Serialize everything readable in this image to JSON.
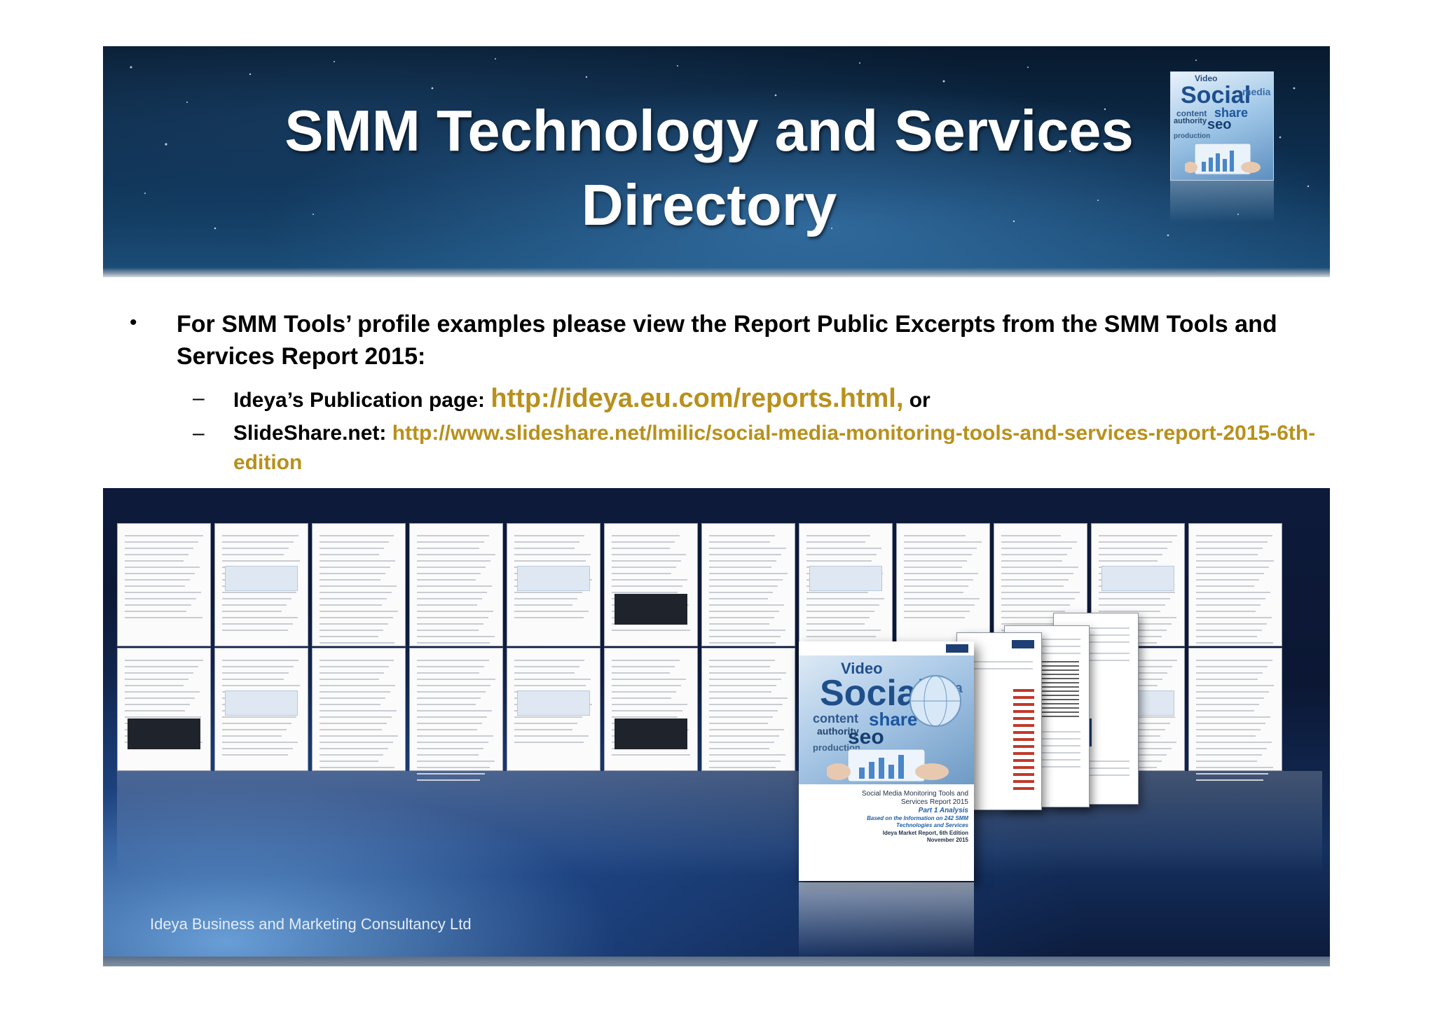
{
  "slide": {
    "title_line1": "SMM Technology and Services",
    "title_line2": "Directory"
  },
  "cube_words": [
    "Video",
    "Social",
    "media",
    "content",
    "share",
    "authority",
    "seo",
    "production"
  ],
  "bullet": {
    "marker": "•",
    "text": "For SMM Tools’ profile examples please view the Report Public Excerpts from the SMM Tools and Services Report 2015:"
  },
  "links": [
    {
      "marker": "–",
      "label": "Ideya’s Publication page: ",
      "url": "http://ideya.eu.com/reports.html,",
      "suffix": " or"
    },
    {
      "marker": "–",
      "label": "SlideShare.net: ",
      "url": "http://www.slideshare.net/lmilic/social-media-monitoring-tools-and-services-report-2015-6th-edition",
      "suffix": ""
    }
  ],
  "report_cover": {
    "title": "Social Media Monitoring Tools and Services Report 2015",
    "part": "Part 1 Analysis",
    "based_on": "Based on the Information on 242 SMM Technologies and Services",
    "edition": "Ideya Market Report, 6th Edition",
    "date": "November 2015"
  },
  "footer": {
    "company": "Ideya Business and Marketing Consultancy Ltd"
  },
  "colors": {
    "link": "#b8901c",
    "banner_dark": "#081a2e",
    "banner_light": "#1c4f7a",
    "title_text": "#ffffff"
  }
}
